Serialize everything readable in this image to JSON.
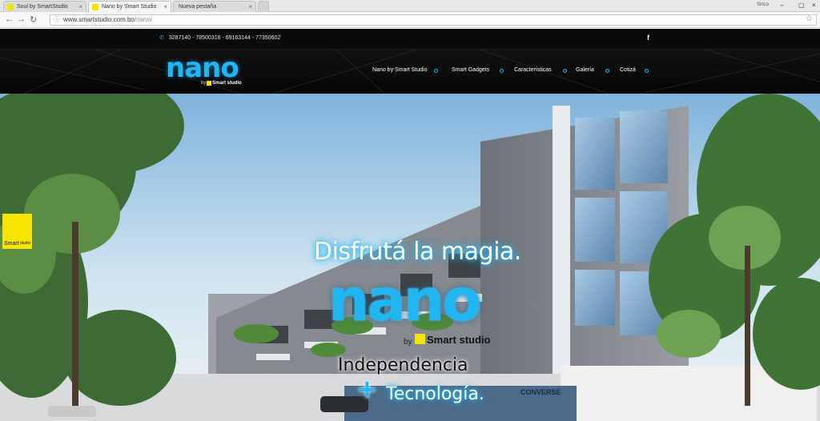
{
  "browser": {
    "tabs": [
      {
        "label": "Soul by SmartStudio",
        "active": false
      },
      {
        "label": "Nano by Smart Studio",
        "active": true
      },
      {
        "label": "Nueva pestaña",
        "active": false
      }
    ],
    "user": "Sinco",
    "url_host": "www.smartstudio.com.bo",
    "url_path": "/nano/"
  },
  "header": {
    "phones": "3287140 - 78500316 - 69163144 - 77350602",
    "facebook_icon": "f",
    "logo_word": "nano",
    "logo_by": "by",
    "logo_brand": "Smart studio",
    "nav": [
      "Nano by Smart Studio",
      "Smart Gadgets",
      "Características",
      "Galería",
      "Cotizá"
    ]
  },
  "hero": {
    "badge_text": "Smart",
    "badge_text2": "studio",
    "tagline": "Disfrutá la magia.",
    "big_word": "nano",
    "by": "by",
    "brand": "Smart studio",
    "line1": "Independencia",
    "plus": "+",
    "line2": "Tecnología.",
    "sign_text": "CONVERSE"
  },
  "colors": {
    "accent": "#1fb6f1",
    "brand_yellow": "#f7e400",
    "header_bg": "#0a0a0a"
  }
}
